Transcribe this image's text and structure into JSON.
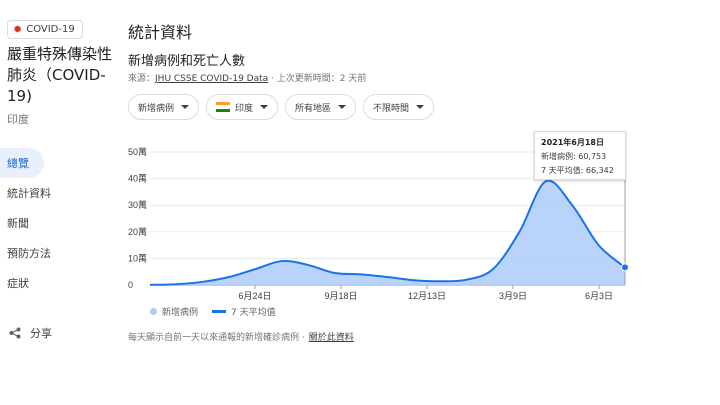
{
  "sidebar": {
    "badge": "COVID-19",
    "title": "嚴重特殊傳染性肺炎（COVID-19)",
    "region": "印度",
    "nav": [
      "總覽",
      "統計資料",
      "新聞",
      "預防方法",
      "症狀"
    ],
    "share": "分享"
  },
  "main": {
    "page_title": "統計資料",
    "section_title": "新增病例和死亡人數",
    "source_prefix": "來源：",
    "source_link": "JHU CSSE COVID-19 Data",
    "source_suffix": " · 上次更新時間：2 天前",
    "filters": [
      "新增病例",
      "印度",
      "所有地區",
      "不限時間"
    ],
    "legend": {
      "cases": "新增病例",
      "avg": "7 天平均值"
    },
    "footnote": "每天顯示自前一天以來通報的新增確診病例 ·",
    "footnote_link": "關於此資料",
    "tooltip": {
      "date": "2021年6月18日",
      "cases": "新增病例: 60,753",
      "avg": "7 天平均值: 66,342"
    }
  },
  "colors": {
    "accent": "#1a73e8",
    "area": "#aecbfa",
    "virus": "#d93025"
  },
  "chart_data": {
    "type": "area",
    "y_ticks": [
      "50萬",
      "40萬",
      "30萬",
      "20萬",
      "10萬",
      "0"
    ],
    "x_ticks": [
      "6月24日",
      "9月18日",
      "12月13日",
      "3月9日",
      "6月3日"
    ],
    "ylim": [
      0,
      500000
    ],
    "series": [
      {
        "name": "7 天平均值",
        "values": [
          500,
          3000,
          12000,
          30000,
          60000,
          90000,
          75000,
          45000,
          40000,
          30000,
          18000,
          14000,
          20000,
          60000,
          200000,
          390000,
          300000,
          150000,
          66342
        ]
      }
    ]
  }
}
